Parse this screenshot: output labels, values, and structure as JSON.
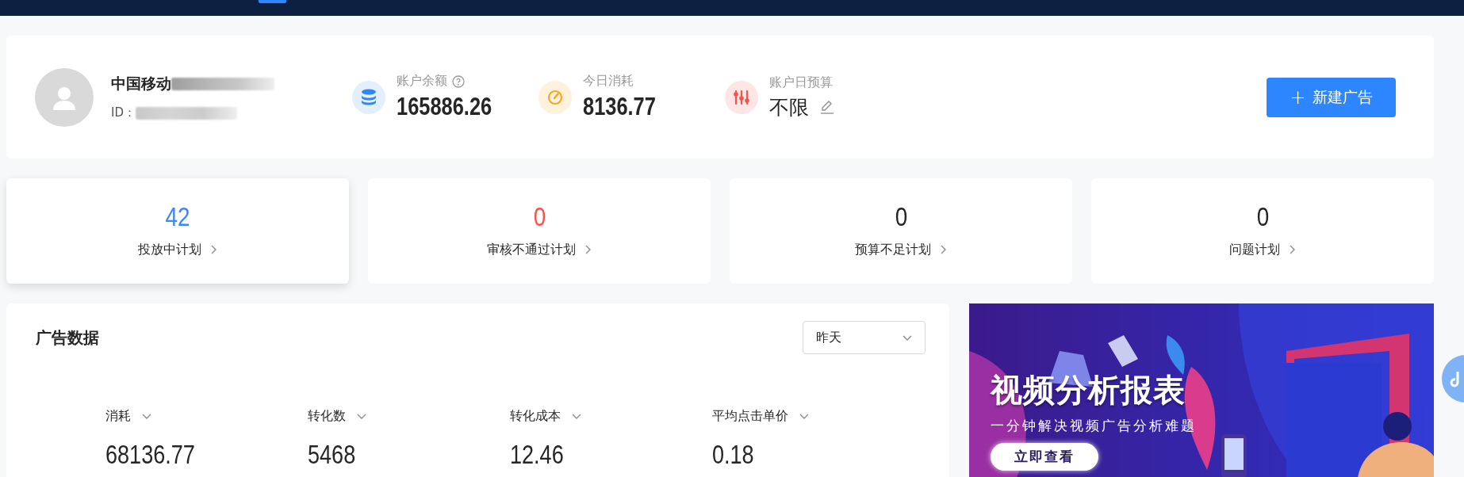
{
  "account": {
    "name": "中国移动",
    "id_label": "ID：",
    "stats": [
      {
        "kind": "balance",
        "label": "账户余额",
        "value": "165886.26",
        "help": true,
        "editable": false
      },
      {
        "kind": "spend",
        "label": "今日消耗",
        "value": "8136.77",
        "help": false,
        "editable": false
      },
      {
        "kind": "budget",
        "label": "账户日预算",
        "value": "不限",
        "help": false,
        "editable": true
      }
    ],
    "new_button": {
      "icon": "+",
      "label": "新建广告"
    }
  },
  "status_cards": [
    {
      "count": "42",
      "label": "投放中计划",
      "color": "#3a87f7",
      "selected": true
    },
    {
      "count": "0",
      "label": "审核不通过计划",
      "color": "#f5534a",
      "selected": false
    },
    {
      "count": "0",
      "label": "预算不足计划",
      "color": "#262626",
      "selected": false
    },
    {
      "count": "0",
      "label": "问题计划",
      "color": "#262626",
      "selected": false
    }
  ],
  "ad_data": {
    "title": "广告数据",
    "range": "昨天",
    "metrics": [
      {
        "label": "消耗",
        "value": "68136.77"
      },
      {
        "label": "转化数",
        "value": "5468"
      },
      {
        "label": "转化成本",
        "value": "12.46"
      },
      {
        "label": "平均点击单价",
        "value": "0.18"
      }
    ]
  },
  "banner": {
    "title": "视频分析报表",
    "subtitle": "一分钟解决视频广告分析难题",
    "button": "立即查看"
  }
}
